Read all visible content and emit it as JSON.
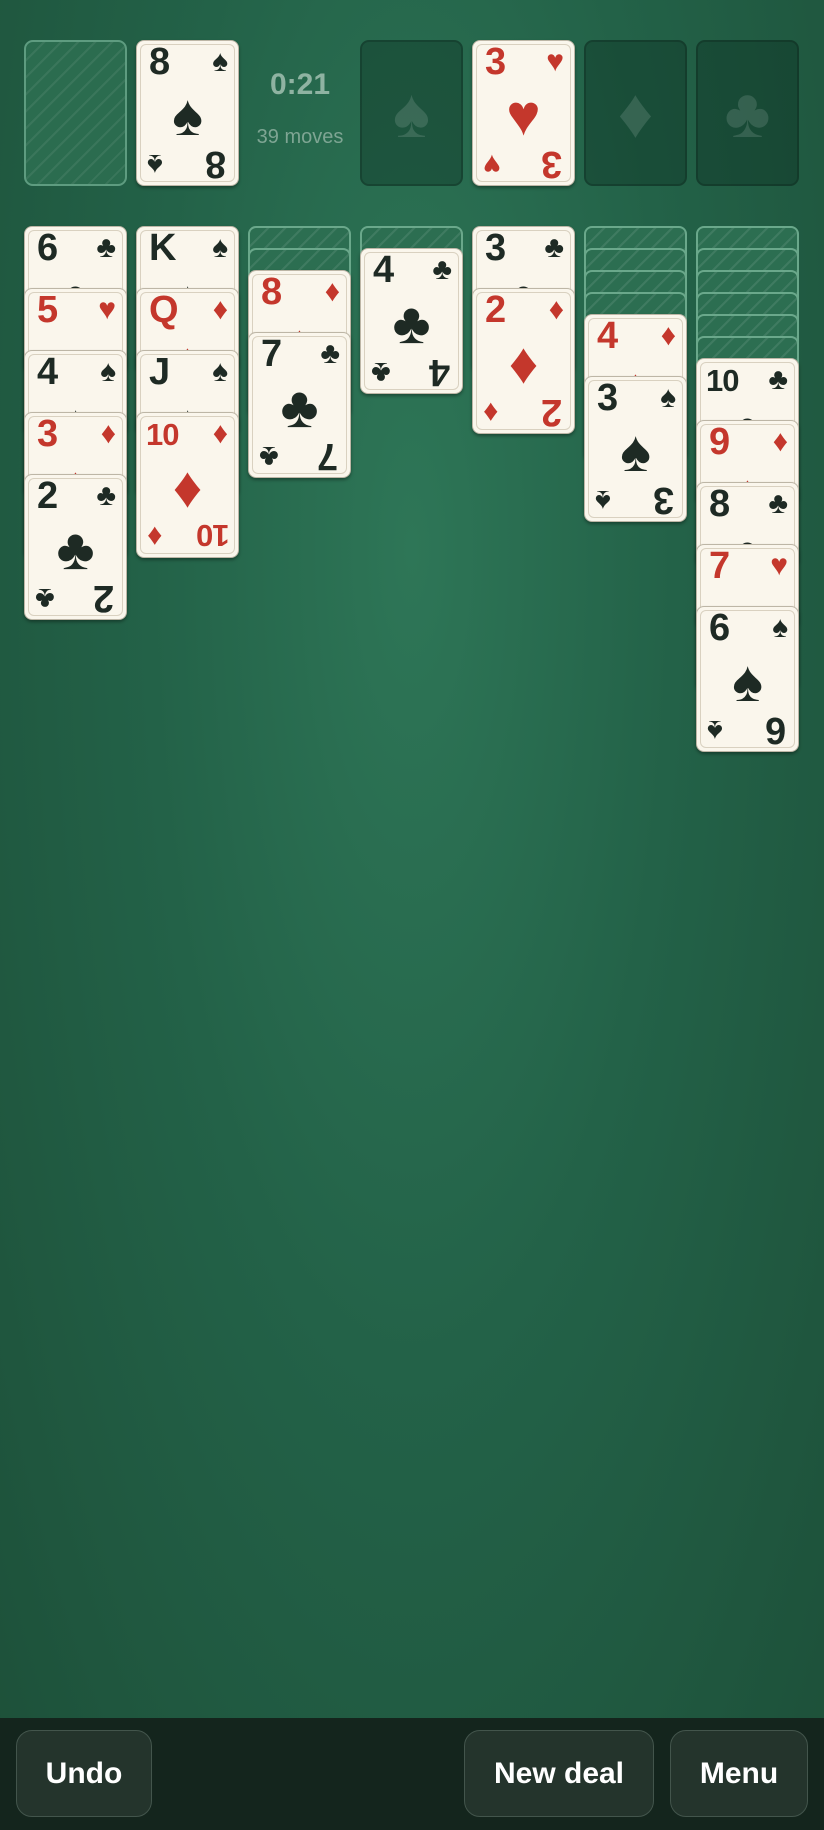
{
  "status": {
    "time": "0:21",
    "moves": "39 moves"
  },
  "colors": {
    "red": "#c4372c",
    "black": "#1e2a24",
    "felt": "#236248"
  },
  "waste": {
    "rank": "8",
    "suit": "♠",
    "color": "black"
  },
  "foundations": [
    {
      "empty": true,
      "suit": "♠",
      "icon": "spade-icon"
    },
    {
      "empty": false,
      "rank": "3",
      "suit": "♥",
      "color": "red"
    },
    {
      "empty": true,
      "suit": "♦",
      "icon": "diamond-icon"
    },
    {
      "empty": true,
      "suit": "♣",
      "icon": "club-icon"
    }
  ],
  "tableau": [
    {
      "hidden": 0,
      "cards": [
        {
          "rank": "6",
          "suit": "♣",
          "color": "black"
        },
        {
          "rank": "5",
          "suit": "♥",
          "color": "red"
        },
        {
          "rank": "4",
          "suit": "♠",
          "color": "black"
        },
        {
          "rank": "3",
          "suit": "♦",
          "color": "red"
        },
        {
          "rank": "2",
          "suit": "♣",
          "color": "black"
        }
      ]
    },
    {
      "hidden": 0,
      "cards": [
        {
          "rank": "K",
          "suit": "♠",
          "color": "black"
        },
        {
          "rank": "Q",
          "suit": "♦",
          "color": "red"
        },
        {
          "rank": "J",
          "suit": "♠",
          "color": "black"
        },
        {
          "rank": "10",
          "suit": "♦",
          "color": "red"
        }
      ]
    },
    {
      "hidden": 2,
      "cards": [
        {
          "rank": "8",
          "suit": "♦",
          "color": "red"
        },
        {
          "rank": "7",
          "suit": "♣",
          "color": "black"
        }
      ]
    },
    {
      "hidden": 1,
      "cards": [
        {
          "rank": "4",
          "suit": "♣",
          "color": "black"
        }
      ]
    },
    {
      "hidden": 0,
      "cards": [
        {
          "rank": "3",
          "suit": "♣",
          "color": "black"
        },
        {
          "rank": "2",
          "suit": "♦",
          "color": "red"
        }
      ]
    },
    {
      "hidden": 4,
      "cards": [
        {
          "rank": "4",
          "suit": "♦",
          "color": "red"
        },
        {
          "rank": "3",
          "suit": "♠",
          "color": "black"
        }
      ]
    },
    {
      "hidden": 6,
      "cards": [
        {
          "rank": "10",
          "suit": "♣",
          "color": "black"
        },
        {
          "rank": "9",
          "suit": "♦",
          "color": "red"
        },
        {
          "rank": "8",
          "suit": "♣",
          "color": "black"
        },
        {
          "rank": "7",
          "suit": "♥",
          "color": "red"
        },
        {
          "rank": "6",
          "suit": "♠",
          "color": "black"
        }
      ]
    }
  ],
  "buttons": {
    "undo": "Undo",
    "new_deal": "New deal",
    "menu": "Menu"
  }
}
